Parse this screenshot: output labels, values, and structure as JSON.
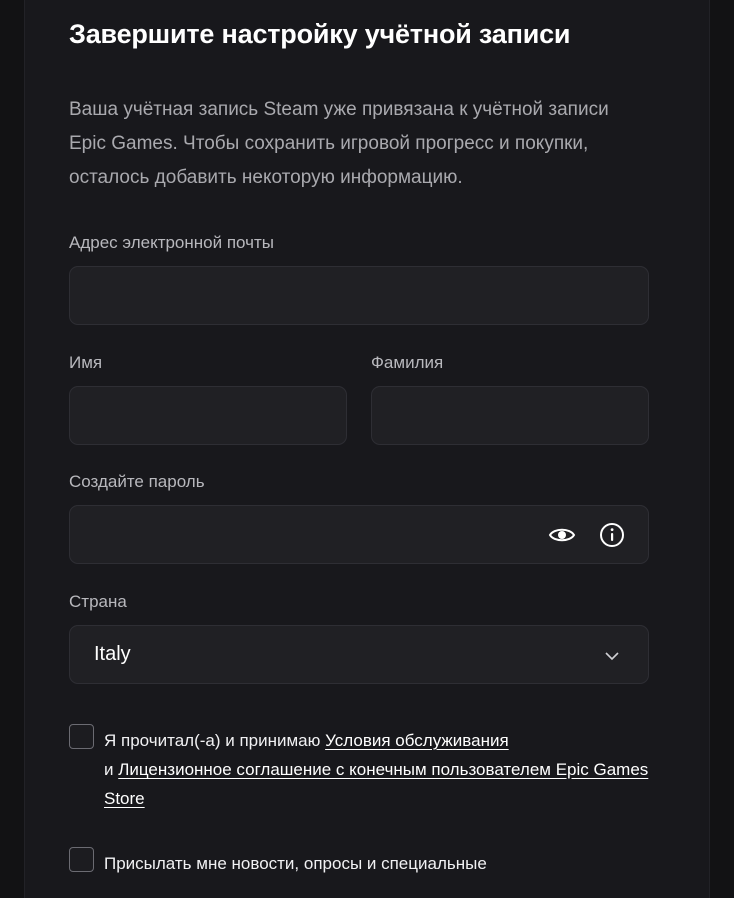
{
  "form": {
    "title": "Завершите настройку учётной записи",
    "description": "Ваша учётная запись Steam уже привязана к учётной записи Epic Games. Чтобы сохранить игровой прогресс и покупки, осталось добавить некоторую информацию.",
    "email_label": "Адрес электронной почты",
    "email_value": "",
    "first_name_label": "Имя",
    "first_name_value": "",
    "last_name_label": "Фамилия",
    "last_name_value": "",
    "password_label": "Создайте пароль",
    "password_value": "",
    "country_label": "Страна",
    "country_value": "Italy"
  },
  "terms": {
    "prefix": "Я прочитал(-а) и принимаю ",
    "tos_link": "Условия обслуживания",
    "and": "и ",
    "eula_link": "Лицензионное соглашение с конечным пользователем Epic Games Store"
  },
  "newsletter": {
    "text": "Присылать мне новости, опросы и специальные"
  },
  "icons": {
    "password_visibility": "eye-icon",
    "password_info": "info-icon",
    "country_dropdown": "chevron-down-icon"
  },
  "colors": {
    "background": "#121214",
    "panel": "#18181c",
    "field": "#202024",
    "text": "#ffffff",
    "muted": "#a9a9ae"
  }
}
